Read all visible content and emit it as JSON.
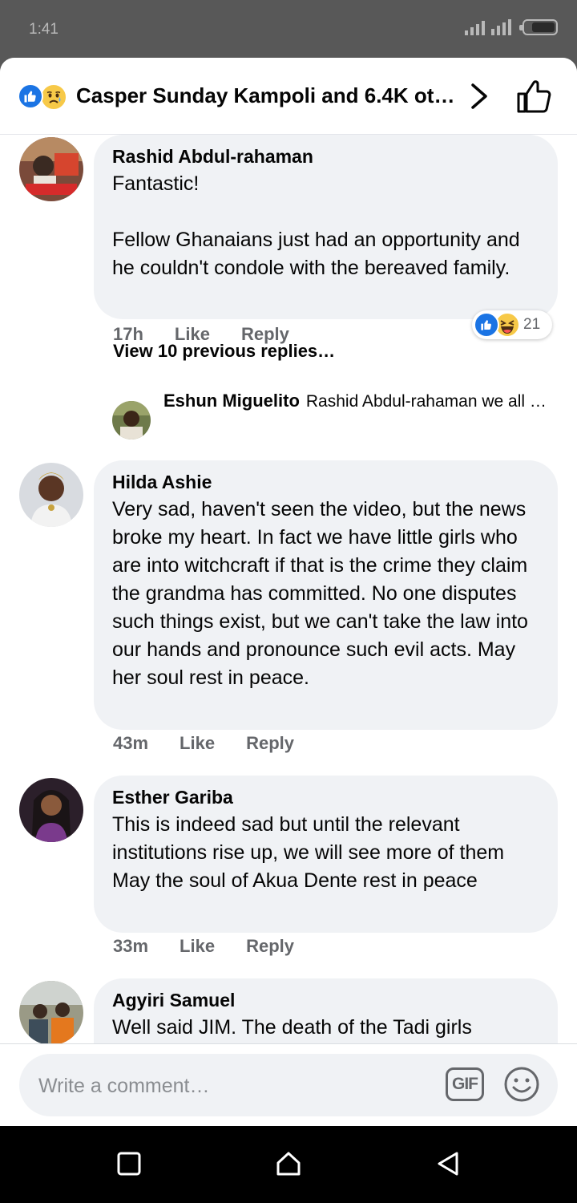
{
  "status_bar": {
    "time": "1:41",
    "battery_level": 0.6
  },
  "header": {
    "reaction_icons": [
      "like-reaction-icon",
      "sad-reaction-icon"
    ],
    "title": "Casper Sunday Kampoli and 6.4K oth…",
    "like_color": "#1b74e4"
  },
  "comments": [
    {
      "author": "Rashid Abdul-rahaman",
      "text": "Fantastic!\n\nFellow Ghanaians just had an opportunity and he couldn't condole with the bereaved family.",
      "time": "17h",
      "like_label": "Like",
      "reply_label": "Reply",
      "reactions": {
        "icons": [
          "like-reaction-icon",
          "haha-reaction-icon"
        ],
        "count": "21"
      },
      "view_previous": "View 10 previous replies…",
      "reply_preview": {
        "author": "Eshun Miguelito",
        "text": "Rashid Abdul-rahaman we all …"
      }
    },
    {
      "author": "Hilda Ashie",
      "text": "Very sad, haven't seen the video, but the news broke my heart. In fact we have little girls who are into witchcraft if that is the crime they claim the grandma has committed. No one disputes such things exist, but we can't take the law into our hands and pronounce such evil acts. May her soul rest in peace.",
      "time": "43m",
      "like_label": "Like",
      "reply_label": "Reply"
    },
    {
      "author": "Esther Gariba",
      "text": "This is indeed sad but until the relevant institutions rise up, we will see more of them\nMay the soul of Akua Dente rest in peace",
      "time": "33m",
      "like_label": "Like",
      "reply_label": "Reply"
    },
    {
      "author": "Agyiri Samuel",
      "text": "Well said JIM.  The death of the Tadi girls"
    }
  ],
  "composer": {
    "placeholder": "Write a comment…",
    "gif_label": "GIF",
    "emoji_icon": "smiley-icon"
  },
  "nav_bar": {
    "buttons": [
      "recents-square-icon",
      "home-icon",
      "back-triangle-icon"
    ]
  }
}
